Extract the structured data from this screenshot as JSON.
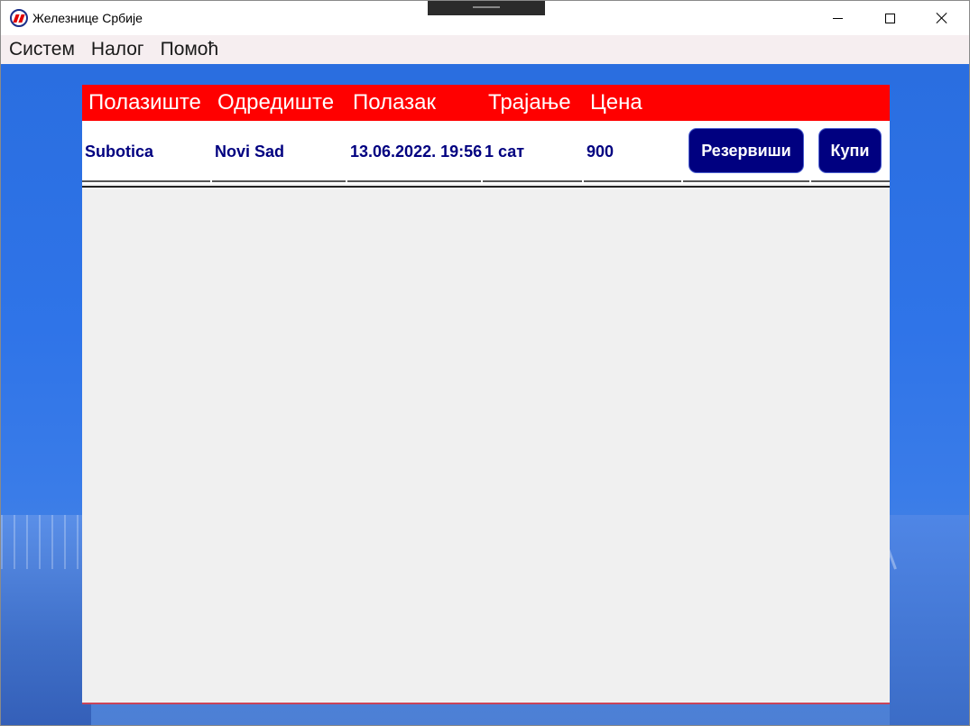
{
  "window": {
    "title": "Железнице Србије",
    "logo_icon": "zs-logo-icon"
  },
  "menu": {
    "items": [
      "Систем",
      "Налог",
      "Помоћ"
    ]
  },
  "table": {
    "header_color": "#ff0000",
    "row_text_color": "#000080",
    "columns": [
      "Полазиште",
      "Одредиште",
      "Полазак",
      "Трајање",
      "Цена"
    ],
    "rows": [
      {
        "from": "Subotica",
        "to": "Novi Sad",
        "departure": "13.06.2022. 19:56",
        "duration": "1 сат",
        "price": "900",
        "reserve_label": "Резервиши",
        "buy_label": "Купи"
      }
    ]
  }
}
